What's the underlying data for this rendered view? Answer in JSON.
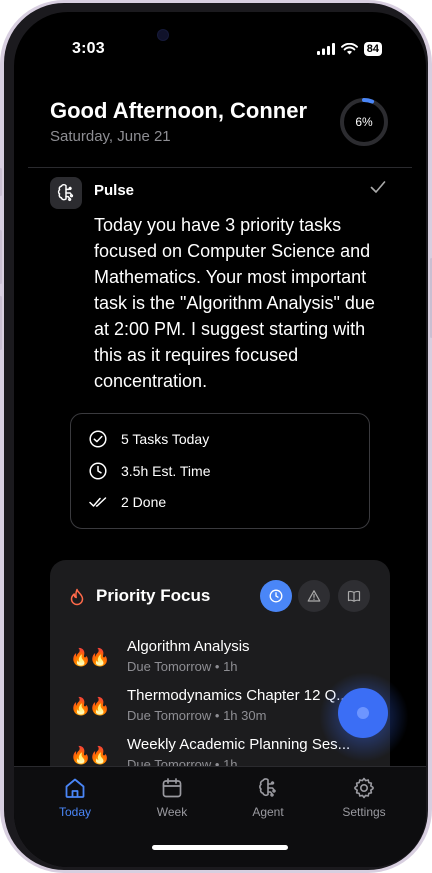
{
  "status_bar": {
    "time": "3:03",
    "battery": "84"
  },
  "header": {
    "greeting": "Good Afternoon, Conner",
    "date": "Saturday, June 21",
    "progress_label": "6%",
    "progress_fraction": 0.06,
    "accent": "#4a86f7"
  },
  "pulse": {
    "title": "Pulse",
    "message": "Today you have 3 priority tasks focused on Computer Science and Mathematics. Your most important task is the \"Algorithm Analysis\" due at 2:00 PM. I suggest starting with this as it requires focused concentration."
  },
  "stats": [
    {
      "icon": "check-circle-icon",
      "label": "5 Tasks Today"
    },
    {
      "icon": "clock-icon",
      "label": "3.5h Est. Time"
    },
    {
      "icon": "double-check-icon",
      "label": "2 Done"
    }
  ],
  "priority_focus": {
    "title": "Priority Focus",
    "filters": [
      "clock-icon",
      "warning-icon",
      "book-icon"
    ],
    "tasks": [
      {
        "title": "Algorithm Analysis",
        "meta": "Due Tomorrow • 1h",
        "flames": "🔥🔥"
      },
      {
        "title": "Thermodynamics Chapter 12 Q...",
        "meta": "Due Tomorrow • 1h 30m",
        "flames": "🔥🔥"
      },
      {
        "title": "Weekly Academic Planning Ses...",
        "meta": "Due Tomorrow • 1h",
        "flames": "🔥🔥"
      }
    ]
  },
  "tabs": [
    {
      "label": "Today",
      "icon": "home-icon",
      "active": true
    },
    {
      "label": "Week",
      "icon": "calendar-icon",
      "active": false
    },
    {
      "label": "Agent",
      "icon": "brain-icon",
      "active": false
    },
    {
      "label": "Settings",
      "icon": "gear-icon",
      "active": false
    }
  ]
}
